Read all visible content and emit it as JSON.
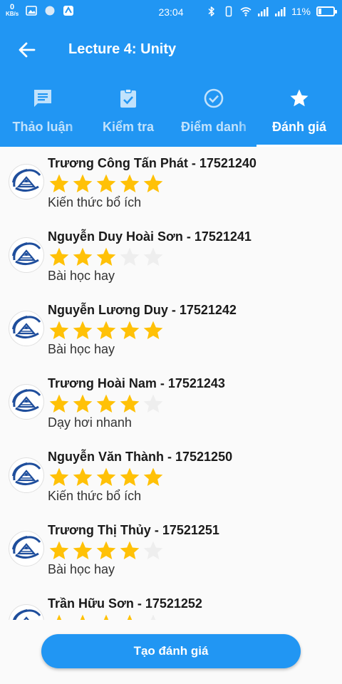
{
  "status_bar": {
    "net_speed_value": "0",
    "net_speed_unit": "KB/s",
    "time": "23:04",
    "battery": "11%"
  },
  "app_bar": {
    "title": "Lecture 4: Unity"
  },
  "tabs": [
    {
      "label": "Thảo luận",
      "icon": "forum-icon",
      "active": false
    },
    {
      "label": "Kiểm tra",
      "icon": "assignment-check-icon",
      "active": false
    },
    {
      "label": "Điểm danh",
      "icon": "check-circle-icon",
      "active": false
    },
    {
      "label": "Đánh giá",
      "icon": "star-icon",
      "active": true
    }
  ],
  "colors": {
    "primary": "#2196f3",
    "star_filled": "#ffc107",
    "star_empty": "#eeeeee"
  },
  "reviews": [
    {
      "name": "Trương Công Tấn Phát - 17521240",
      "rating": 5,
      "comment": "Kiến thức bổ ích"
    },
    {
      "name": "Nguyễn Duy Hoài Sơn - 17521241",
      "rating": 3,
      "comment": "Bài học hay"
    },
    {
      "name": "Nguyễn Lương Duy - 17521242",
      "rating": 5,
      "comment": "Bài học hay"
    },
    {
      "name": "Trương Hoài Nam - 17521243",
      "rating": 4,
      "comment": "Dạy hơi nhanh"
    },
    {
      "name": "Nguyễn Văn Thành - 17521250",
      "rating": 5,
      "comment": "Kiến thức bổ ích"
    },
    {
      "name": "Trương Thị Thủy - 17521251",
      "rating": 4,
      "comment": "Bài học hay"
    },
    {
      "name": "Trần Hữu Sơn - 17521252",
      "rating": 4,
      "comment": ""
    }
  ],
  "cta": {
    "label": "Tạo đánh giá"
  }
}
